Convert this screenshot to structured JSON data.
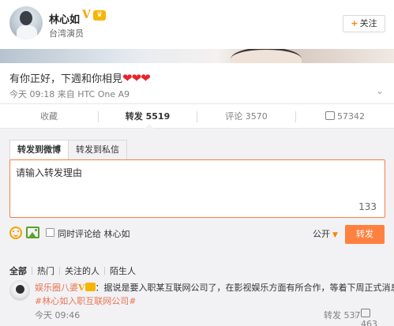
{
  "user": {
    "name": "林心如",
    "verified": "V",
    "description": "台湾演员"
  },
  "follow_button": {
    "plus": "+",
    "label": "关注"
  },
  "post": {
    "text": "有你正好，下週和你相見",
    "hearts": "❤❤❤",
    "time": "今天 09:18",
    "source": "来自 HTC One A9",
    "more": "⌄"
  },
  "actions": {
    "favorite": "收藏",
    "repost_label": "转发",
    "repost_count": "5519",
    "comment_label": "评论",
    "comment_count": "3570",
    "like_count": "57342"
  },
  "repost_panel": {
    "tab_weibo": "转发到微博",
    "tab_private": "转发到私信",
    "placeholder": "请输入转发理由",
    "char_count": "133",
    "also_comment": "同时评论给 林心如",
    "visibility": "公开",
    "visibility_chevron": "▼",
    "submit": "转发"
  },
  "filters": [
    "全部",
    "热门",
    "关注的人",
    "陌生人"
  ],
  "comment": {
    "user": "娱乐圈八婆",
    "verified": "V",
    "text": "：据说是要入职某互联网公司了，在影视娱乐方面有所合作，等着下周正式消息吧",
    "topic": "#林心如入职互联网公司#",
    "time": "今天 09:46",
    "repost_label": "转发",
    "repost_count": "537",
    "like_count": "463"
  },
  "colors": {
    "accent": "#ff8140",
    "link": "#eb7350",
    "verified": "#f5a300",
    "heart": "#e8232a"
  }
}
